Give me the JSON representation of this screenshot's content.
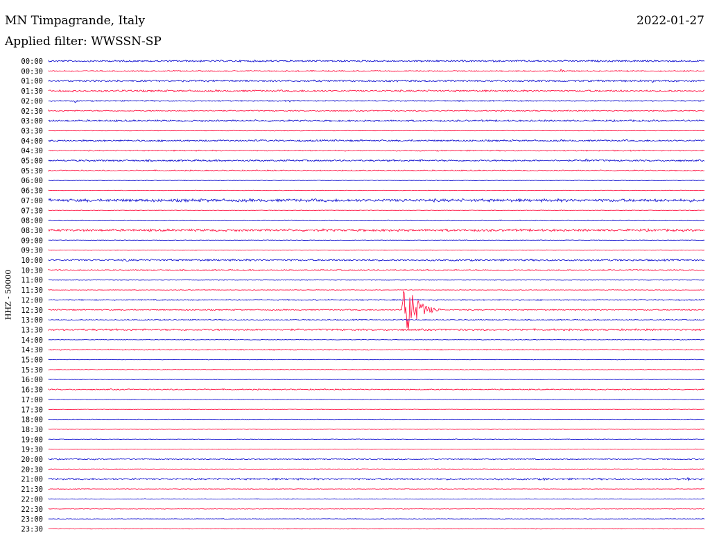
{
  "header": {
    "station": "MN Timpagrande, Italy",
    "date": "2022-01-27",
    "filter": "Applied filter: WWSSN-SP"
  },
  "colors": {
    "blue": "#0000cc",
    "red": "#ff0033"
  },
  "chart_data": {
    "type": "line",
    "ylabel": "HHZ - 50000",
    "rows": [
      "00:00",
      "00:30",
      "01:00",
      "01:30",
      "02:00",
      "02:30",
      "03:00",
      "03:30",
      "04:00",
      "04:30",
      "05:00",
      "05:30",
      "06:00",
      "06:30",
      "07:00",
      "07:30",
      "08:00",
      "08:30",
      "09:00",
      "09:30",
      "10:00",
      "10:30",
      "11:00",
      "11:30",
      "12:00",
      "12:30",
      "13:00",
      "13:30",
      "14:00",
      "14:30",
      "15:00",
      "15:30",
      "16:00",
      "16:30",
      "17:00",
      "17:30",
      "18:00",
      "18:30",
      "19:00",
      "19:30",
      "20:00",
      "20:30",
      "21:00",
      "21:30",
      "22:00",
      "22:30",
      "23:00",
      "23:30"
    ],
    "x_range_minutes": [
      0,
      30
    ],
    "noise_levels": [
      1.5,
      1,
      1.5,
      1.5,
      1,
      1,
      1.5,
      0.5,
      1.5,
      1,
      1.5,
      1,
      0.5,
      0.5,
      2.5,
      0.5,
      0.5,
      2,
      0.5,
      0.5,
      1.5,
      1,
      0.5,
      0.5,
      1,
      1,
      1,
      1.5,
      0.5,
      1,
      0.5,
      0.5,
      0.5,
      1,
      0.5,
      0.5,
      0.5,
      0.5,
      0.5,
      0.5,
      1,
      0.5,
      1.5,
      0.5,
      0.5,
      0.5,
      0.5,
      0.5
    ],
    "events": [
      {
        "row": 1,
        "minute": 23.4,
        "amplitude": 4,
        "duration_min": 0.5
      },
      {
        "row": 2,
        "minute": 27.6,
        "amplitude": 3,
        "duration_min": 0.3
      },
      {
        "row": 3,
        "minute": 3.6,
        "amplitude": 5,
        "duration_min": 0.4
      },
      {
        "row": 4,
        "minute": 1.2,
        "amplitude": 4,
        "duration_min": 0.3
      },
      {
        "row": 4,
        "minute": 11.0,
        "amplitude": 3,
        "duration_min": 0.2
      },
      {
        "row": 10,
        "minute": 16.9,
        "amplitude": 3,
        "duration_min": 0.6
      },
      {
        "row": 10,
        "minute": 24.5,
        "amplitude": 3,
        "duration_min": 1.5
      },
      {
        "row": 20,
        "minute": 3.5,
        "amplitude": 3,
        "duration_min": 0.8
      },
      {
        "row": 20,
        "minute": 24.8,
        "amplitude": 2,
        "duration_min": 0.6
      },
      {
        "row": 24,
        "minute": 12.8,
        "amplitude": 2,
        "duration_min": 0.6
      },
      {
        "row": 24,
        "minute": 21.2,
        "amplitude": 2,
        "duration_min": 0.5
      },
      {
        "row": 25,
        "minute": 16.2,
        "amplitude": 56,
        "duration_min": 1.5
      },
      {
        "row": 42,
        "minute": 3.8,
        "amplitude": 3,
        "duration_min": 0.8
      },
      {
        "row": 42,
        "minute": 22.6,
        "amplitude": 3,
        "duration_min": 1.0
      },
      {
        "row": 42,
        "minute": 29.2,
        "amplitude": 3,
        "duration_min": 0.5
      }
    ]
  }
}
